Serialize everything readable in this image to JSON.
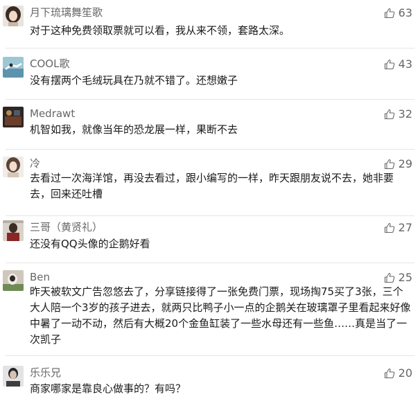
{
  "comments": [
    {
      "username": "月下琉璃舞笙歌",
      "likes": "63",
      "text": "对于这种免费领取票就可以看，我从来不领，套路太深。"
    },
    {
      "username": "COOL歌",
      "likes": "43",
      "text": "没有摆两个毛绒玩具在乃就不错了。还想嫩子"
    },
    {
      "username": "Medrawt",
      "likes": "32",
      "text": "机智如我，就像当年的恐龙展一样，果断不去"
    },
    {
      "username": "冷",
      "likes": "29",
      "text": "去看过一次海洋馆，再没去看过，跟小编写的一样，昨天跟朋友说不去，她非要去，回来还吐槽"
    },
    {
      "username": "三哥（黄贤礼）",
      "likes": "27",
      "text": "还没有QQ头像的企鹅好看"
    },
    {
      "username": "Ben",
      "likes": "25",
      "text": "昨天被软文广告忽悠去了，分享链接得了一张免费门票，现场掏75买了3张，三个大人陪一个3岁的孩子进去，就两只比鸭子小一点的企鹅关在玻璃罩子里看起来好像中暑了一动不动，然后有大概20个金鱼缸装了一些水母还有一些鱼……真是当了一次凯子"
    },
    {
      "username": "乐乐兄",
      "likes": "20",
      "text": "商家哪家是靠良心做事的？有吗？"
    }
  ]
}
